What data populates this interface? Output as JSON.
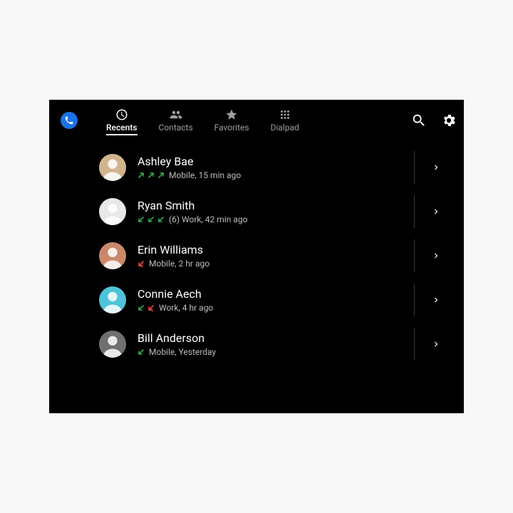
{
  "tabs": [
    {
      "id": "recents",
      "label": "Recents",
      "active": true
    },
    {
      "id": "contacts",
      "label": "Contacts",
      "active": false
    },
    {
      "id": "favorites",
      "label": "Favorites",
      "active": false
    },
    {
      "id": "dialpad",
      "label": "Dialpad",
      "active": false
    }
  ],
  "calls": [
    {
      "name": "Ashley Bae",
      "arrows": [
        "out",
        "out",
        "out"
      ],
      "count": "",
      "detail": "Mobile, 15 min ago",
      "avatar_bg": "#d2b48c"
    },
    {
      "name": "Ryan Smith",
      "arrows": [
        "in",
        "in",
        "in"
      ],
      "count": "(6)",
      "detail": "Work, 42 min ago",
      "avatar_bg": "#e8e8e8"
    },
    {
      "name": "Erin Williams",
      "arrows": [
        "missed"
      ],
      "count": "",
      "detail": "Mobile, 2 hr ago",
      "avatar_bg": "#c9886a"
    },
    {
      "name": "Connie Aech",
      "arrows": [
        "in",
        "missed"
      ],
      "count": "",
      "detail": "Work, 4 hr ago",
      "avatar_bg": "#4fc3d9"
    },
    {
      "name": "Bill Anderson",
      "arrows": [
        "in"
      ],
      "count": "",
      "detail": "Mobile, Yesterday",
      "avatar_bg": "#707070"
    }
  ]
}
